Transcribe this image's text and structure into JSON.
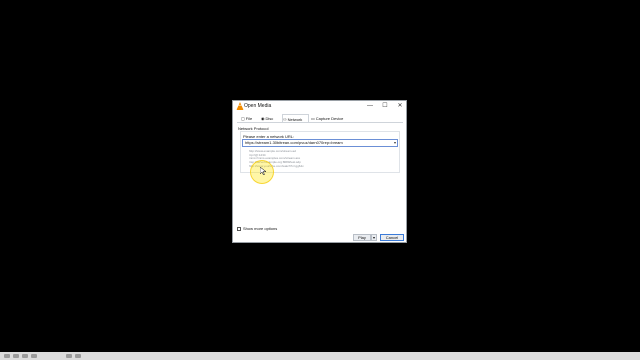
{
  "window": {
    "title": "Open Media",
    "controls": {
      "minimize": "—",
      "maximize": "☐",
      "close": "✕"
    }
  },
  "tabs": [
    {
      "label": "File",
      "icon": "file-icon"
    },
    {
      "label": "Disc",
      "icon": "disc-icon"
    },
    {
      "label": "Network",
      "icon": "network-icon",
      "active": true
    },
    {
      "label": "Capture Device",
      "icon": "capture-device-icon"
    }
  ],
  "network": {
    "group_title": "Network Protocol",
    "prompt": "Please enter a network URL:",
    "url_value": "https://stream1.30bitrean.com/pvuz/darn070rep=bream",
    "examples": [
      "http://www.example.com/stream.avi",
      "rtp://@:1234",
      "mms://mms.examples.com/stream.asx",
      "rtsp://server.example.org:8080/test.sdp",
      "http://www.yourtube.com/watch?v=gg64x"
    ]
  },
  "options": {
    "show_more": "Show more options"
  },
  "buttons": {
    "play": "Play",
    "play_menu": "▾",
    "cancel": "Cancel"
  },
  "colors": {
    "accent": "#3b7bd8",
    "highlight": "#ffe600",
    "background": "#000000"
  }
}
